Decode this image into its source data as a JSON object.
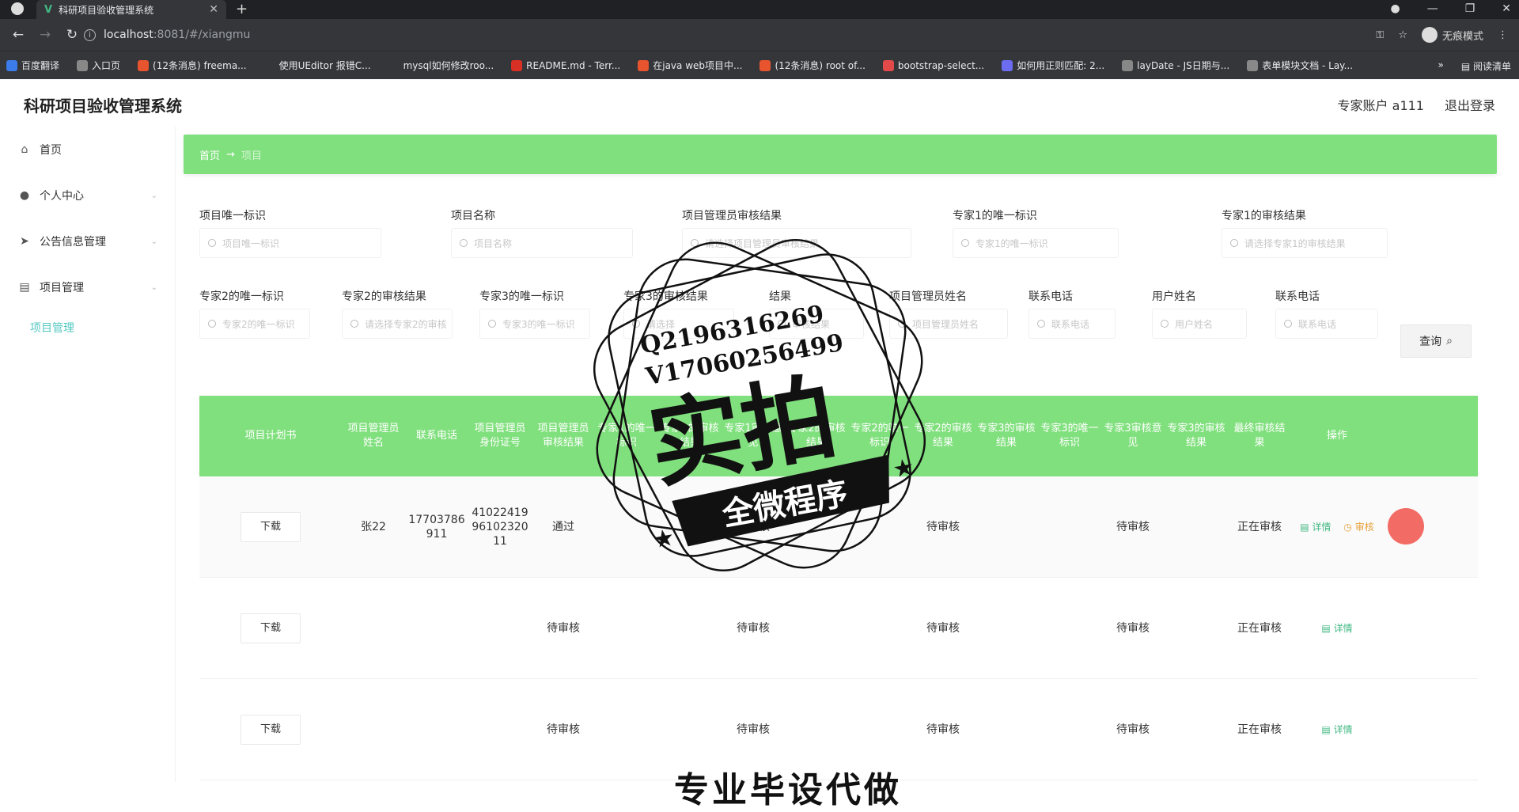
{
  "browser": {
    "tab_title": "科研项目验收管理系统",
    "url_host": "localhost",
    "url_path": ":8081/#/xiangmu",
    "incognito_label": "无痕模式",
    "bookmarks": [
      "百度翻译",
      "入口页",
      "(12条消息) freema...",
      "使用UEditor 报错C...",
      "mysql如何修改roo...",
      "README.md - Terr...",
      "在java web项目中...",
      "(12条消息) root of...",
      "bootstrap-select...",
      "如何用正则匹配: 2...",
      "layDate - JS日期与...",
      "表单模块文档 - Lay..."
    ],
    "reading_list": "阅读清单",
    "colors": {
      "bookmark_icons": [
        "#3b7bea",
        "#888",
        "#e8542e",
        "#35363a",
        "#35363a",
        "#d93025",
        "#e8542e",
        "#e8542e",
        "#e24a4a",
        "#6c6cf0",
        "#888",
        "#888"
      ]
    }
  },
  "header": {
    "title": "科研项目验收管理系统",
    "account": "专家账户 a111",
    "logout": "退出登录"
  },
  "sidebar": {
    "items": [
      {
        "label": "首页",
        "icon": "home-icon",
        "glyph": "⌂",
        "has_arrow": false
      },
      {
        "label": "个人中心",
        "icon": "user-icon",
        "glyph": "●",
        "has_arrow": true
      },
      {
        "label": "公告信息管理",
        "icon": "send-icon",
        "glyph": "➤",
        "has_arrow": true
      },
      {
        "label": "项目管理",
        "icon": "list-icon",
        "glyph": "▤",
        "has_arrow": true
      }
    ],
    "sub_item": "项目管理",
    "arrow": "⌄"
  },
  "breadcrumb": {
    "home": "首页",
    "sep": "→",
    "current": "项目"
  },
  "filters": {
    "row1": [
      {
        "label": "项目唯一标识",
        "placeholder": "项目唯一标识"
      },
      {
        "label": "项目名称",
        "placeholder": "项目名称"
      },
      {
        "label": "项目管理员审核结果",
        "placeholder": "请选择项目管理员审核结果"
      },
      {
        "label": "专家1的唯一标识",
        "placeholder": "专家1的唯一标识"
      },
      {
        "label": "专家1的审核结果",
        "placeholder": "请选择专家1的审核结果"
      }
    ],
    "row2": [
      {
        "label": "专家2的唯一标识",
        "placeholder": "专家2的唯一标识"
      },
      {
        "label": "专家2的审核结果",
        "placeholder": "请选择专家2的审核"
      },
      {
        "label": "专家3的唯一标识",
        "placeholder": "专家3的唯一标识"
      },
      {
        "label": "专家3的审核结果",
        "placeholder": "请选择"
      },
      {
        "label": "结果",
        "placeholder": "审核结果"
      },
      {
        "label": "项目管理员姓名",
        "placeholder": "项目管理员姓名"
      },
      {
        "label": "联系电话",
        "placeholder": "联系电话"
      },
      {
        "label": "用户姓名",
        "placeholder": "用户姓名"
      },
      {
        "label": "联系电话",
        "placeholder": "联系电话"
      }
    ],
    "query_button": "查询",
    "query_icon": "⌕"
  },
  "table": {
    "headers": [
      "项目计划书",
      "项目管理员姓名",
      "联系电话",
      "项目管理员身份证号",
      "项目管理员审核结果",
      "专家1的唯一标识",
      "专家1的审核结果",
      "专家1审核意见",
      "专家2的审核结果",
      "专家2的唯一标识",
      "专家2的审核结果",
      "专家3的审核结果",
      "专家3的唯一标识",
      "专家3审核意见",
      "专家3的审核结果",
      "最终审核结果",
      "操作"
    ],
    "rows": [
      {
        "download": "下载",
        "name": "张22",
        "phone": "17703786911",
        "idcard": "410224199610232011",
        "admin_result": "通过",
        "e1": "待审核",
        "e2": "待审核",
        "e3": "待审核",
        "final": "正在审核",
        "actions": [
          "详情",
          "审核"
        ]
      },
      {
        "download": "下载",
        "name": "",
        "phone": "",
        "idcard": "",
        "admin_result": "待审核",
        "e1": "待审核",
        "e2": "待审核",
        "e3": "待审核",
        "final": "正在审核",
        "actions": [
          "详情"
        ]
      },
      {
        "download": "下载",
        "name": "",
        "phone": "",
        "idcard": "",
        "admin_result": "待审核",
        "e1": "待审核",
        "e2": "待审核",
        "e3": "待审核",
        "final": "正在审核",
        "actions": [
          "详情"
        ]
      }
    ]
  },
  "watermark": {
    "line1": "Q2196316269",
    "line2": "V17060256499",
    "main": "实拍",
    "ribbon": "全微程序",
    "bottom": "专业毕设代做"
  },
  "colors": {
    "accent": "#81e07e",
    "teal": "#54c9c1",
    "link": "#41b883",
    "warn": "#e6a23c",
    "cursor": "#f0524a"
  }
}
